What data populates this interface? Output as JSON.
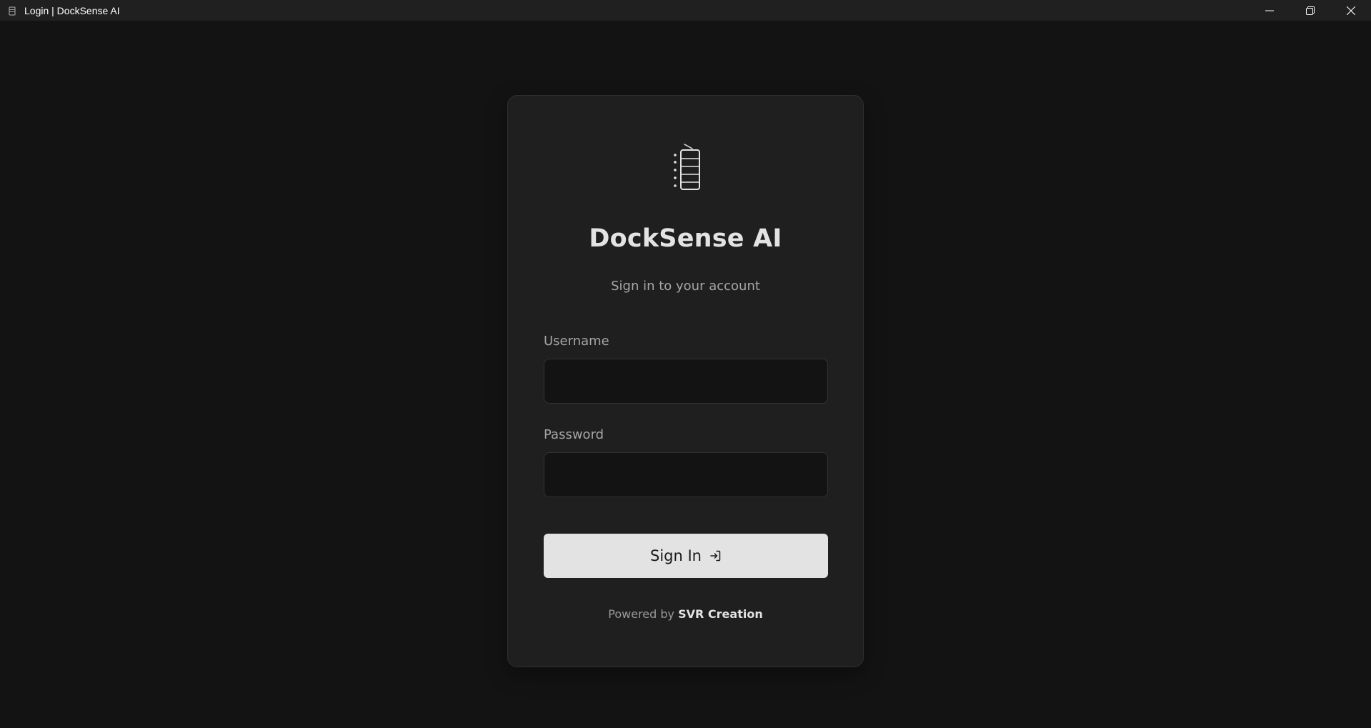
{
  "window": {
    "title": "Login | DockSense AI",
    "icon": "app-icon",
    "controls": [
      "minimize-icon",
      "restore-icon",
      "close-icon"
    ]
  },
  "login": {
    "logo_icon": "document-list-icon",
    "app_name": "DockSense AI",
    "subtitle": "Sign in to your account",
    "username": {
      "label": "Username",
      "value": "",
      "placeholder": ""
    },
    "password": {
      "label": "Password",
      "value": "",
      "placeholder": ""
    },
    "signin": {
      "label": "Sign In",
      "icon": "sign-in-icon"
    },
    "footer": {
      "prefix": "Powered by",
      "brand": "SVR Creation"
    }
  },
  "colors": {
    "background": "#131313",
    "card": "#1f1f1f",
    "titlebar": "#202020",
    "button": "#e3e3e3",
    "text_primary": "#e3e3e3",
    "text_secondary": "#a6a6a6"
  }
}
